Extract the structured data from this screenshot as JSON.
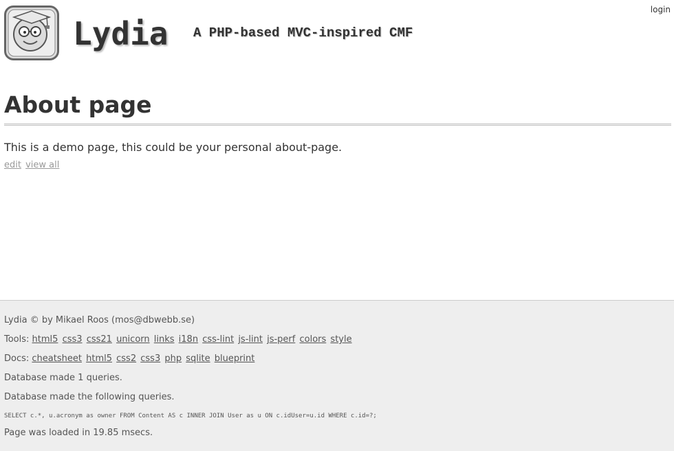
{
  "header": {
    "site_title": "Lydia",
    "slogan": "A PHP-based MVC-inspired CMF",
    "login_label": "login",
    "logo_icon": "graduate-face-icon"
  },
  "main": {
    "title": "About page",
    "body": "This is a demo page, this could be your personal about-page.",
    "actions": [
      "edit",
      "view all"
    ]
  },
  "footer": {
    "credit": "Lydia © by Mikael Roos (mos@dbwebb.se)",
    "tools_label": "Tools:",
    "tools": [
      "html5",
      "css3",
      "css21",
      "unicorn",
      "links",
      "i18n",
      "css-lint",
      "js-lint",
      "js-perf",
      "colors",
      "style"
    ],
    "docs_label": "Docs:",
    "docs": [
      "cheatsheet",
      "html5",
      "css2",
      "css3",
      "php",
      "sqlite",
      "blueprint"
    ],
    "db_count": "Database made 1 queries.",
    "db_following": "Database made the following queries.",
    "sql": "SELECT c.*, u.acronym as owner FROM Content AS c INNER JOIN User as u ON c.idUser=u.id WHERE c.id=?;",
    "load_time": "Page was loaded in 19.85 msecs."
  },
  "colors": {
    "text": "#333333",
    "muted_link": "#999999",
    "footer_bg": "#eeeeee"
  }
}
